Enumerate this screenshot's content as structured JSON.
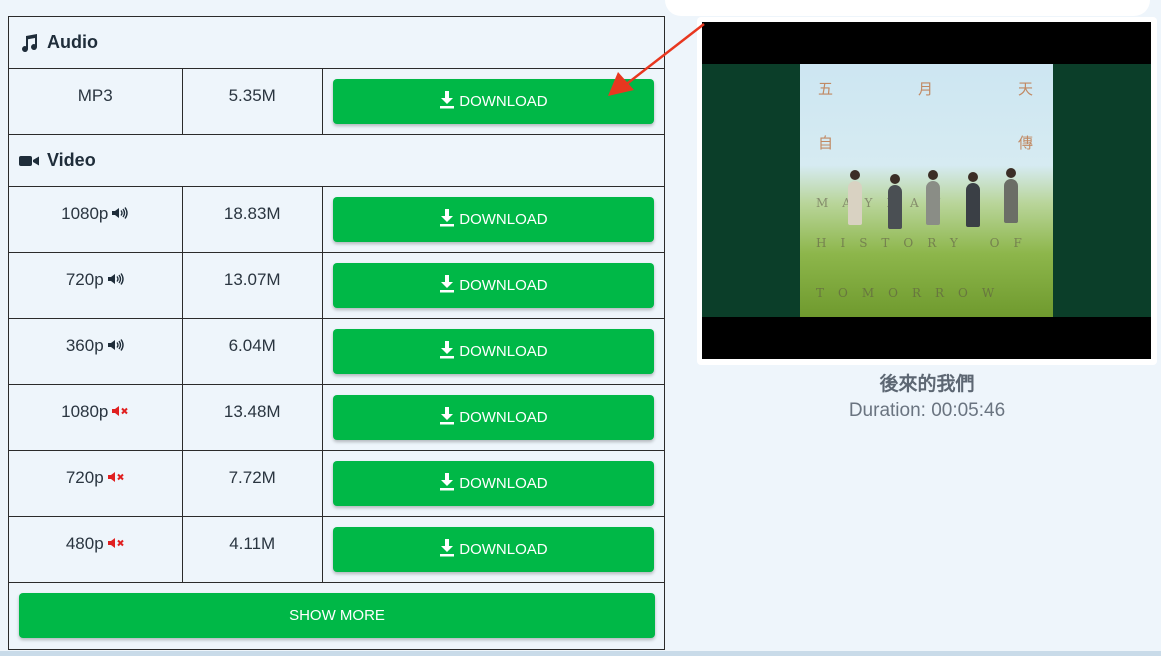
{
  "audio_section": {
    "title": "Audio",
    "rows": [
      {
        "quality": "MP3",
        "size": "5.35M",
        "action": "DOWNLOAD"
      }
    ]
  },
  "video_section": {
    "title": "Video",
    "rows": [
      {
        "quality": "1080p",
        "size": "18.83M",
        "audio": "on",
        "action": "DOWNLOAD"
      },
      {
        "quality": "720p",
        "size": "13.07M",
        "audio": "on",
        "action": "DOWNLOAD"
      },
      {
        "quality": "360p",
        "size": "6.04M",
        "audio": "on",
        "action": "DOWNLOAD"
      },
      {
        "quality": "1080p",
        "size": "13.48M",
        "audio": "muted",
        "action": "DOWNLOAD"
      },
      {
        "quality": "720p",
        "size": "7.72M",
        "audio": "muted",
        "action": "DOWNLOAD"
      },
      {
        "quality": "480p",
        "size": "4.11M",
        "audio": "muted",
        "action": "DOWNLOAD"
      }
    ]
  },
  "show_more_label": "SHOW MORE",
  "video_info": {
    "title": "後來的我們",
    "duration": "Duration: 00:05:46",
    "cover_text": {
      "top_left": "五",
      "top_center": "月",
      "top_right": "天",
      "mid_left": "自",
      "mid_right": "傳",
      "line1": "MAYDAY",
      "line2": "HISTORY OF",
      "line3": "TOMORROW"
    }
  },
  "colors": {
    "button_green": "#00b847",
    "muted_icon_red": "#e02020",
    "arrow_red": "#e8371f",
    "page_bg": "#eef5fb"
  },
  "icons": {
    "audio": "music-note-icon",
    "video": "video-camera-icon",
    "download": "download-arrow-icon",
    "sound_on": "speaker-on-icon",
    "sound_muted": "speaker-muted-icon"
  }
}
